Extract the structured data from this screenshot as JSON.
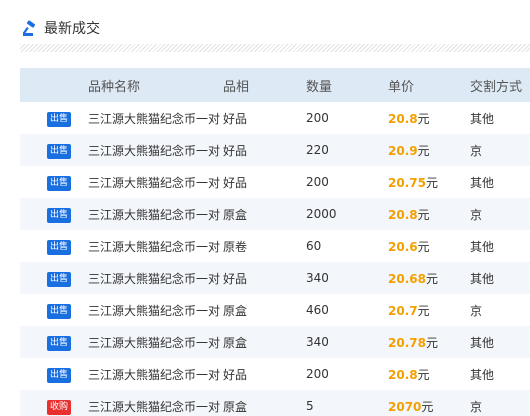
{
  "header": {
    "title": "最新成交"
  },
  "columns": [
    "",
    "品种名称",
    "品相",
    "数量",
    "单价",
    "交割方式"
  ],
  "rows": [
    {
      "tag": "出售",
      "type": "sell",
      "name": "三江源大熊猫纪念币一对",
      "quality": "好品",
      "qty": "200",
      "price": "20.8",
      "unit": "元",
      "trade": "其他"
    },
    {
      "tag": "出售",
      "type": "sell",
      "name": "三江源大熊猫纪念币一对",
      "quality": "好品",
      "qty": "220",
      "price": "20.9",
      "unit": "元",
      "trade": "京"
    },
    {
      "tag": "出售",
      "type": "sell",
      "name": "三江源大熊猫纪念币一对",
      "quality": "好品",
      "qty": "200",
      "price": "20.75",
      "unit": "元",
      "trade": "其他"
    },
    {
      "tag": "出售",
      "type": "sell",
      "name": "三江源大熊猫纪念币一对",
      "quality": "原盒",
      "qty": "2000",
      "price": "20.8",
      "unit": "元",
      "trade": "京"
    },
    {
      "tag": "出售",
      "type": "sell",
      "name": "三江源大熊猫纪念币一对",
      "quality": "原卷",
      "qty": "60",
      "price": "20.6",
      "unit": "元",
      "trade": "其他"
    },
    {
      "tag": "出售",
      "type": "sell",
      "name": "三江源大熊猫纪念币一对",
      "quality": "好品",
      "qty": "340",
      "price": "20.68",
      "unit": "元",
      "trade": "其他"
    },
    {
      "tag": "出售",
      "type": "sell",
      "name": "三江源大熊猫纪念币一对",
      "quality": "原盒",
      "qty": "460",
      "price": "20.7",
      "unit": "元",
      "trade": "京"
    },
    {
      "tag": "出售",
      "type": "sell",
      "name": "三江源大熊猫纪念币一对",
      "quality": "原盒",
      "qty": "340",
      "price": "20.78",
      "unit": "元",
      "trade": "其他"
    },
    {
      "tag": "出售",
      "type": "sell",
      "name": "三江源大熊猫纪念币一对",
      "quality": "好品",
      "qty": "200",
      "price": "20.8",
      "unit": "元",
      "trade": "其他"
    },
    {
      "tag": "收购",
      "type": "buy",
      "name": "三江源大熊猫纪念币一对",
      "quality": "原盒",
      "qty": "5",
      "price": "2070",
      "unit": "元",
      "trade": "京"
    }
  ],
  "colors": {
    "sell_tag": "#1a6fe0",
    "buy_tag": "#e8312f",
    "price": "#f4a000",
    "header_bg": "#dde9f5"
  },
  "icons": {
    "header": "auction-hammer-icon"
  }
}
